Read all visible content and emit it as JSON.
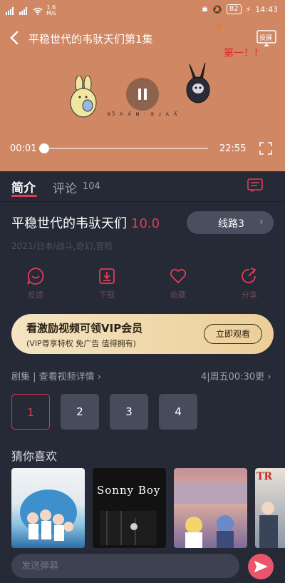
{
  "status_bar": {
    "speed_top": "1.6",
    "speed_unit": "M/s",
    "battery": "82",
    "time": "14:43"
  },
  "player": {
    "title": "平稳世代的韦驮天们第1集",
    "cast_label": "投屏",
    "overlay_text": "第一！！",
    "overlay_small": "第一",
    "subtitle_scrawl": "ɘɔ̃ ʌ ʎ ɴ · ɘ ɹ ʌ ʎ",
    "current_time": "00:01",
    "total_time": "22:55",
    "progress_fraction": 0.001
  },
  "tabs": {
    "intro": "简介",
    "comments": "评论",
    "comments_count": "104"
  },
  "anime": {
    "title": "平稳世代的韦驮天们",
    "score": "10.0",
    "route_label": "线路3",
    "meta": "2021/日本/战斗,奇幻,冒险"
  },
  "actions": [
    {
      "label": "反馈",
      "icon": "feedback-icon"
    },
    {
      "label": "下载",
      "icon": "download-icon"
    },
    {
      "label": "收藏",
      "icon": "heart-icon"
    },
    {
      "label": "分享",
      "icon": "share-icon"
    }
  ],
  "vip": {
    "title": "看激励视频可领VIP会员",
    "subtitle": "(VIP尊享特权 免广告 值得拥有)",
    "button": "立即观看"
  },
  "episodes": {
    "header": "剧集 | 查看视频详情",
    "header_chevron": "›",
    "update": "4|周五00:30更",
    "update_chevron": "›",
    "items": [
      "1",
      "2",
      "3",
      "4"
    ],
    "active": "1"
  },
  "recommendations": {
    "title": "猜你喜欢",
    "posters": [
      {
        "text": ""
      },
      {
        "text": "Sonny Boy"
      },
      {
        "text": ""
      },
      {
        "text": "TR"
      }
    ]
  },
  "bottom": {
    "placeholder": "发送弹幕"
  },
  "colors": {
    "accent": "#e23c56",
    "background": "#262a36",
    "video_bg": "#cf8764"
  }
}
